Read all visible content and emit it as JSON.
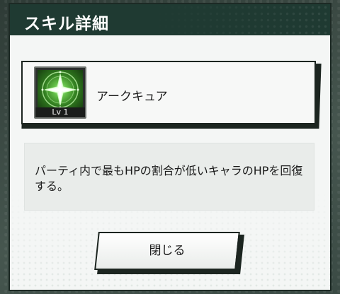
{
  "dialog": {
    "title": "スキル詳細",
    "close_label": "閉じる"
  },
  "skill": {
    "icon": "sparkle-star-icon",
    "level_label": "Lv 1",
    "name": "アークキュア",
    "description": "パーティ内で最もHPの割合が低いキャラのHPを回復する。"
  },
  "colors": {
    "title_bar": "#1f3a32",
    "panel": "#f4f6f5",
    "icon_glow": "#66c24a"
  }
}
